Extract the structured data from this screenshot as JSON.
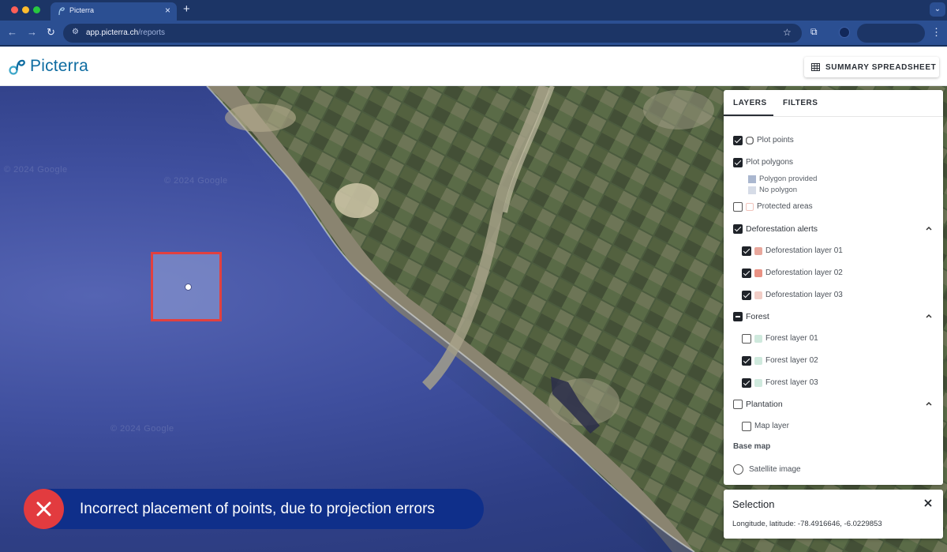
{
  "browser": {
    "tab_title": "Picterra",
    "url_host": "app.picterra.ch",
    "url_path": "/reports",
    "new_tab_symbol": "+",
    "close_tab_symbol": "×",
    "icons": [
      "back-icon",
      "forward-icon",
      "reload-icon",
      "site-info-icon",
      "bookmark-star-icon",
      "extensions-icon",
      "profile-icon",
      "menu-icon"
    ]
  },
  "header": {
    "logo_text": "Picterra",
    "summary_button_label": "SUMMARY SPREADSHEET",
    "summary_icon": "table-icon"
  },
  "map": {
    "watermarks": [
      "© 2024 Google",
      "© 2024 Google",
      "© 2024 Google"
    ]
  },
  "panel": {
    "tabs": [
      {
        "label": "LAYERS",
        "active": true
      },
      {
        "label": "FILTERS",
        "active": false
      }
    ],
    "layers": {
      "plot_points": {
        "label": "Plot points",
        "checked": true
      },
      "plot_polygons": {
        "label": "Plot polygons",
        "checked": true
      },
      "polygon_legend": [
        {
          "label": "Polygon provided",
          "color": "#aab7cf"
        },
        {
          "label": "No polygon",
          "color": "#d6dce7"
        }
      ],
      "protected_areas": {
        "label": "Protected areas",
        "checked": false,
        "color": "#f1c4bc"
      },
      "deforestation": {
        "label": "Deforestation alerts",
        "state": "checked",
        "expanded": true,
        "items": [
          {
            "label": "Deforestation layer 01",
            "checked": true,
            "color": "#e8a79c"
          },
          {
            "label": "Deforestation layer 02",
            "checked": true,
            "color": "#e99183"
          },
          {
            "label": "Deforestation layer 03",
            "checked": true,
            "color": "#f1cdc6"
          }
        ]
      },
      "forest": {
        "label": "Forest",
        "state": "indeterminate",
        "expanded": true,
        "items": [
          {
            "label": "Forest layer 01",
            "checked": false,
            "color": "#cfe9dd"
          },
          {
            "label": "Forest layer 02",
            "checked": true,
            "color": "#cfe9dd"
          },
          {
            "label": "Forest layer 03",
            "checked": true,
            "color": "#cfe9dd"
          }
        ]
      },
      "plantation": {
        "label": "Plantation",
        "state": "unchecked",
        "expanded": true,
        "items": [
          {
            "label": "Map layer",
            "checked": false
          }
        ]
      }
    },
    "base_map": {
      "title": "Base map",
      "option": "Satellite image",
      "selected": false
    }
  },
  "selection": {
    "title": "Selection",
    "coords": "Longitude, latitude: -78.4916646, -6.0229853"
  },
  "banner": {
    "text": "Incorrect placement of points, due to projection errors",
    "icon": "error-x-icon",
    "icon_color": "#e23b3f",
    "background": "#0f2f8a"
  },
  "colors": {
    "chrome_dark": "#1c3566",
    "chrome": "#2b4f92",
    "ocean": "#3f4f9e",
    "plot_border": "#e2403f",
    "logo": "#0e6ca1"
  }
}
